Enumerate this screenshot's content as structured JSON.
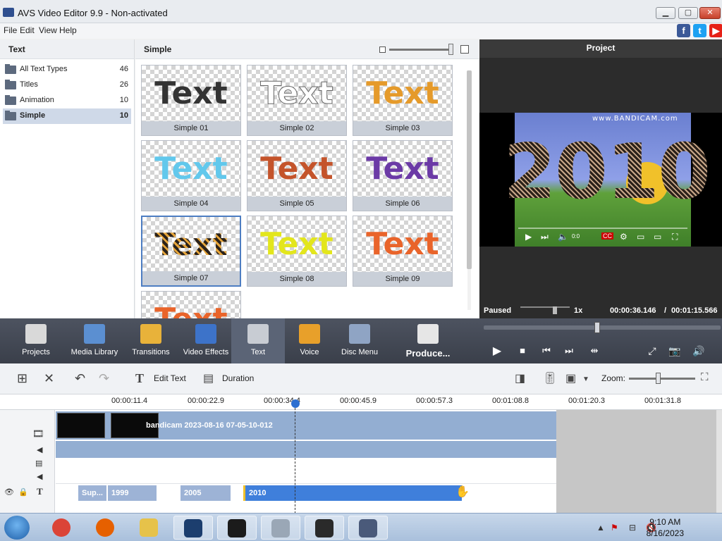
{
  "window": {
    "title": "AVS Video Editor 9.9 - Non-activated",
    "minimize": "▁",
    "maximize": "▢",
    "close": "✕"
  },
  "menu": [
    "File",
    "Edit",
    "View",
    "Help"
  ],
  "social": [
    {
      "name": "facebook-icon",
      "glyph": "f",
      "color": "#3b5998"
    },
    {
      "name": "twitter-icon",
      "glyph": "t",
      "color": "#1da1f2"
    },
    {
      "name": "youtube-icon",
      "glyph": "▶",
      "color": "#e62117"
    }
  ],
  "left_panel": {
    "header": "Text",
    "categories": [
      {
        "label": "All Text Types",
        "count": "46"
      },
      {
        "label": "Titles",
        "count": "26"
      },
      {
        "label": "Animation",
        "count": "10"
      },
      {
        "label": "Simple",
        "count": "10",
        "selected": true
      }
    ]
  },
  "gallery": {
    "header": "Simple",
    "items": [
      {
        "caption": "Simple 01",
        "sample": "Text",
        "color": "#333333"
      },
      {
        "caption": "Simple 02",
        "sample": "Text",
        "color": "#ffffff"
      },
      {
        "caption": "Simple 03",
        "sample": "Text",
        "color": "#e59a2a"
      },
      {
        "caption": "Simple 04",
        "sample": "Text",
        "color": "#62c8ec"
      },
      {
        "caption": "Simple 05",
        "sample": "Text",
        "color": "#c4542b"
      },
      {
        "caption": "Simple 06",
        "sample": "Text",
        "color": "#6b3aa6"
      },
      {
        "caption": "Simple 07",
        "sample": "Text",
        "color": "#2b221a",
        "selected": true
      },
      {
        "caption": "Simple 08",
        "sample": "Text",
        "color": "#e3e61c"
      },
      {
        "caption": "Simple 09",
        "sample": "Text",
        "color": "#e9642a"
      },
      {
        "caption": "",
        "sample": "Text",
        "color": "#e9642a"
      }
    ]
  },
  "preview": {
    "header": "Project",
    "watermark": "www.BANDICAM.com",
    "overlay_text": "2010",
    "status": "Paused",
    "speed": "1x",
    "current_time": "00:00:36.146",
    "separator": "/",
    "total_time": "00:01:15.566",
    "player_time": "0:0"
  },
  "toolbar": {
    "items": [
      {
        "label": "Projects",
        "icon": "clapperboard-icon",
        "color": "#d9d9d9"
      },
      {
        "label": "Media Library",
        "icon": "film-icon",
        "color": "#5b8fd1"
      },
      {
        "label": "Transitions",
        "icon": "transitions-icon",
        "color": "#e8b23a"
      },
      {
        "label": "Video Effects",
        "icon": "star-icon",
        "color": "#3d73c9"
      },
      {
        "label": "Text",
        "icon": "text-icon",
        "color": "#c8ccd3",
        "active": true
      },
      {
        "label": "Voice",
        "icon": "microphone-icon",
        "color": "#e8a02a"
      },
      {
        "label": "Disc Menu",
        "icon": "disc-icon",
        "color": "#8fa4c4"
      },
      {
        "label": "Produce...",
        "icon": "produce-icon",
        "color": "#e6e6e6"
      }
    ]
  },
  "timeline_toolbar": {
    "edit_text": "Edit Text",
    "duration": "Duration",
    "zoom_label": "Zoom:"
  },
  "ruler": [
    "00:00:11.4",
    "00:00:22.9",
    "00:00:34.4",
    "00:00:45.9",
    "00:00:57.3",
    "00:01:08.8",
    "00:01:20.3",
    "00:01:31.8"
  ],
  "tracks": {
    "video_label": "bandicam 2023-08-16 07-05-10-012",
    "text_clips": [
      "Sup...",
      "1999",
      "2005",
      "2010"
    ]
  },
  "taskbar": {
    "time": "9:10 AM",
    "date": "8/16/2023",
    "apps": [
      {
        "name": "chrome-icon",
        "color": "#db4437"
      },
      {
        "name": "firefox-icon",
        "color": "#e66000"
      },
      {
        "name": "file-explorer-icon",
        "color": "#e6c24a"
      },
      {
        "name": "avs-video-editor-taskbar-icon",
        "color": "#1c3e6e"
      },
      {
        "name": "media-app-icon",
        "color": "#1b1b1b"
      },
      {
        "name": "calculator-icon",
        "color": "#9aa7b6"
      },
      {
        "name": "recorder-icon",
        "color": "#2a2a2a"
      },
      {
        "name": "video-editor-icon",
        "color": "#4a5a7a"
      }
    ]
  }
}
